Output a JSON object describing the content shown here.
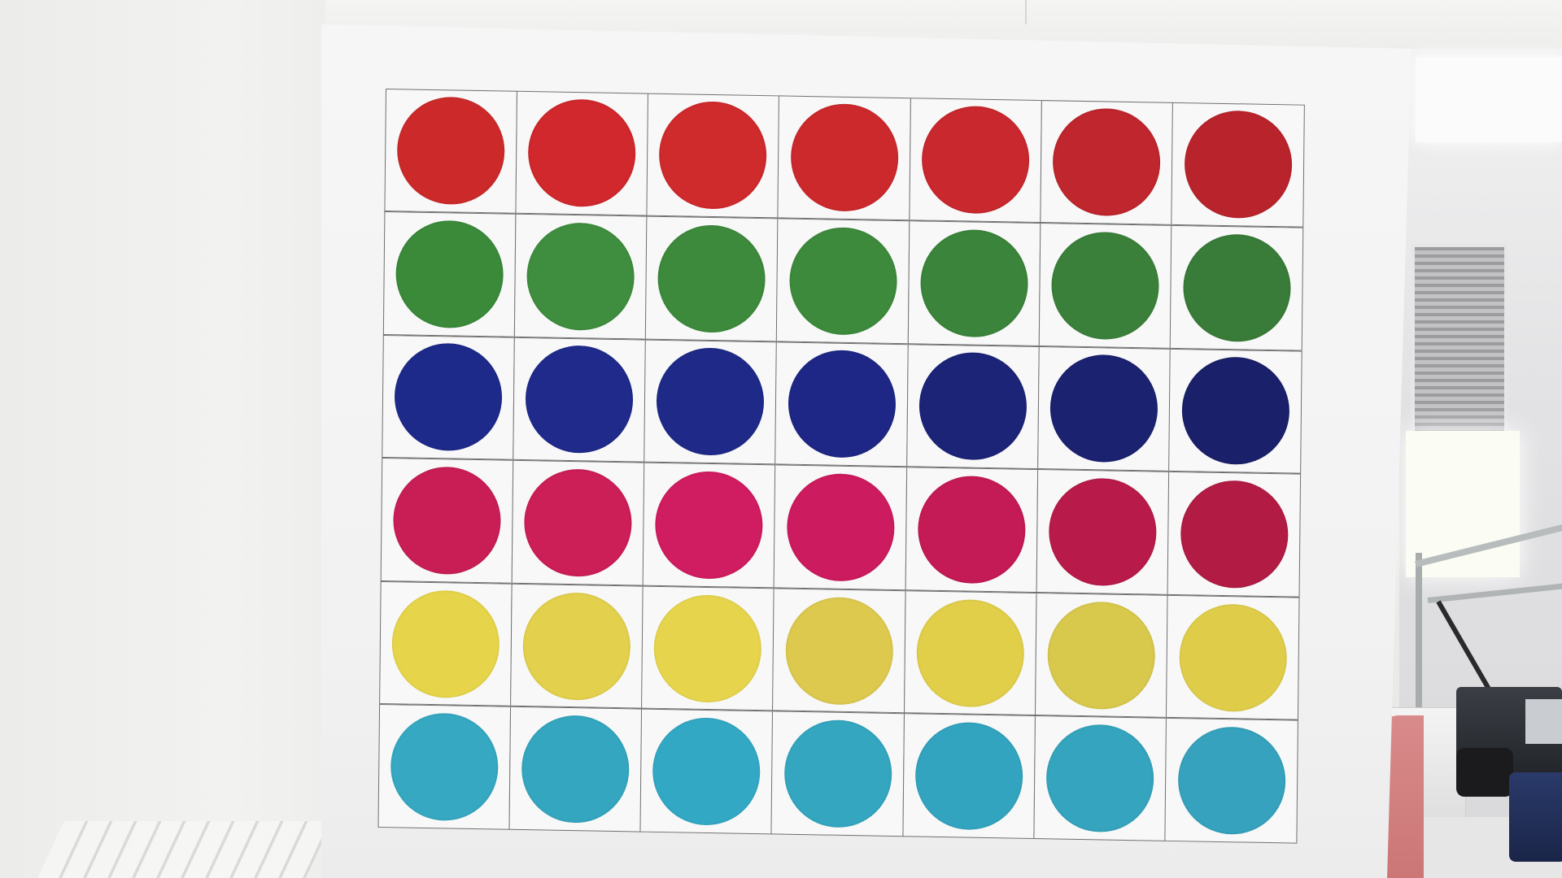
{
  "scene": {
    "background_colors": {
      "wall": "#eeeeec",
      "board": "#f4f4f4",
      "grid_line": "#6f6f6f"
    }
  },
  "color_chart": {
    "rows": 6,
    "columns": 7,
    "row_colors": [
      {
        "name": "red",
        "swatches": [
          "#cc2a2a",
          "#d0282c",
          "#cf2a2c",
          "#cc292d",
          "#c8282e",
          "#bf262d",
          "#b9242c"
        ]
      },
      {
        "name": "green",
        "swatches": [
          "#3a8a3a",
          "#3f8d3e",
          "#3d8a3c",
          "#3d8a3c",
          "#3b843b",
          "#3a803a",
          "#397b39"
        ]
      },
      {
        "name": "blue",
        "swatches": [
          "#1e2a8a",
          "#1f2a8b",
          "#1f2a88",
          "#1e2785",
          "#1c2478",
          "#1b2270",
          "#1a206a"
        ]
      },
      {
        "name": "magenta",
        "swatches": [
          "#c81e55",
          "#cc1e57",
          "#d01c60",
          "#cc1b5e",
          "#c41a55",
          "#b81b4a",
          "#b21c44"
        ]
      },
      {
        "name": "yellow",
        "swatches": [
          "#e6d54a",
          "#e3d04c",
          "#e6d54c",
          "#ddc94e",
          "#e1cf4a",
          "#d8c84c",
          "#dfcd4a"
        ]
      },
      {
        "name": "cyan",
        "swatches": [
          "#36a8c2",
          "#34a6bf",
          "#33a8c4",
          "#34a6c0",
          "#33a4bf",
          "#35a4be",
          "#36a2bd"
        ]
      }
    ]
  }
}
